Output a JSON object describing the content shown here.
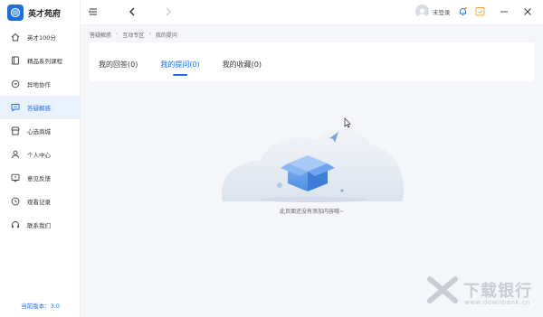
{
  "app": {
    "name": "英才苑府"
  },
  "sidebar": {
    "items": [
      {
        "label": "英才100分",
        "icon": "home-icon"
      },
      {
        "label": "精品系列课程",
        "icon": "book-icon"
      },
      {
        "label": "异地协作",
        "icon": "sync-icon"
      },
      {
        "label": "答疑解惑",
        "icon": "chat-icon",
        "active": true
      },
      {
        "label": "心选商城",
        "icon": "store-icon"
      },
      {
        "label": "个人中心",
        "icon": "user-icon"
      },
      {
        "label": "意见反馈",
        "icon": "feedback-icon"
      },
      {
        "label": "观看记录",
        "icon": "history-icon"
      },
      {
        "label": "联系我们",
        "icon": "headset-icon"
      }
    ],
    "version": "当前版本：3.0"
  },
  "titlebar": {
    "login_label": "未登录"
  },
  "breadcrumb": [
    "答疑解惑",
    "互动专区",
    "我的提问"
  ],
  "tabs": [
    {
      "label": "我的回答(0)"
    },
    {
      "label": "我的提问(0)",
      "active": true
    },
    {
      "label": "我的收藏(0)"
    }
  ],
  "empty_state": {
    "message": "此页面还没有添加内容哦~"
  },
  "watermark": {
    "text": "下载银行",
    "url": "www.downbank.cn"
  },
  "colors": {
    "accent": "#1d6fe0",
    "active_bg": "#e9f1fd",
    "background": "#f4f6f9"
  }
}
